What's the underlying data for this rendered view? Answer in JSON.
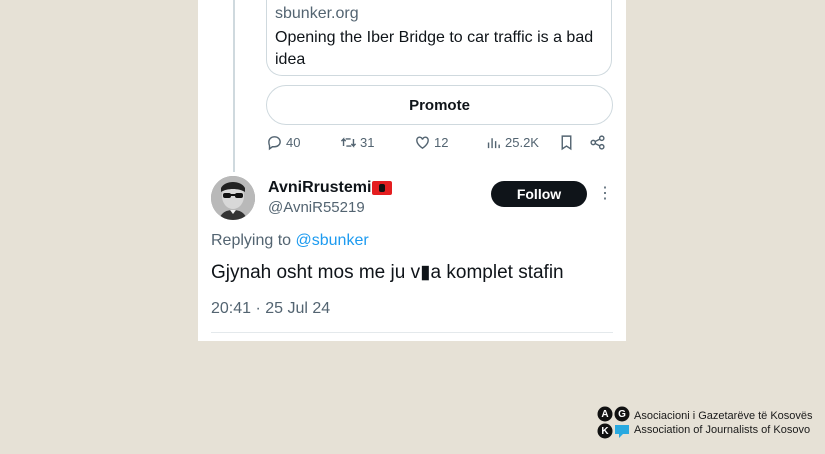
{
  "quoted_link": {
    "domain": "sbunker.org",
    "title": "Opening the Iber Bridge to car traffic is a bad idea"
  },
  "promote_label": "Promote",
  "actions": {
    "replies": "40",
    "reposts": "31",
    "likes": "12",
    "views": "25.2K"
  },
  "reply": {
    "username": "AvniRrustemi",
    "handle": "@AvniR55219",
    "follow_label": "Follow",
    "replying_prefix": "Replying to ",
    "replying_to": "@sbunker",
    "text": "Gjynah osht mos me ju v▮a komplet stafin",
    "timestamp": "20:41 · 25 Jul 24"
  },
  "watermark": {
    "logo_letters": "AGK",
    "line1": "Asociacioni i Gazetarëve të Kosovës",
    "line2": "Association of Journalists of Kosovo"
  },
  "colors": {
    "background": "#e6e1d6",
    "card": "#ffffff",
    "secondary_text": "#536471",
    "mention": "#1d9bf0",
    "follow_button": "#0f1419"
  }
}
